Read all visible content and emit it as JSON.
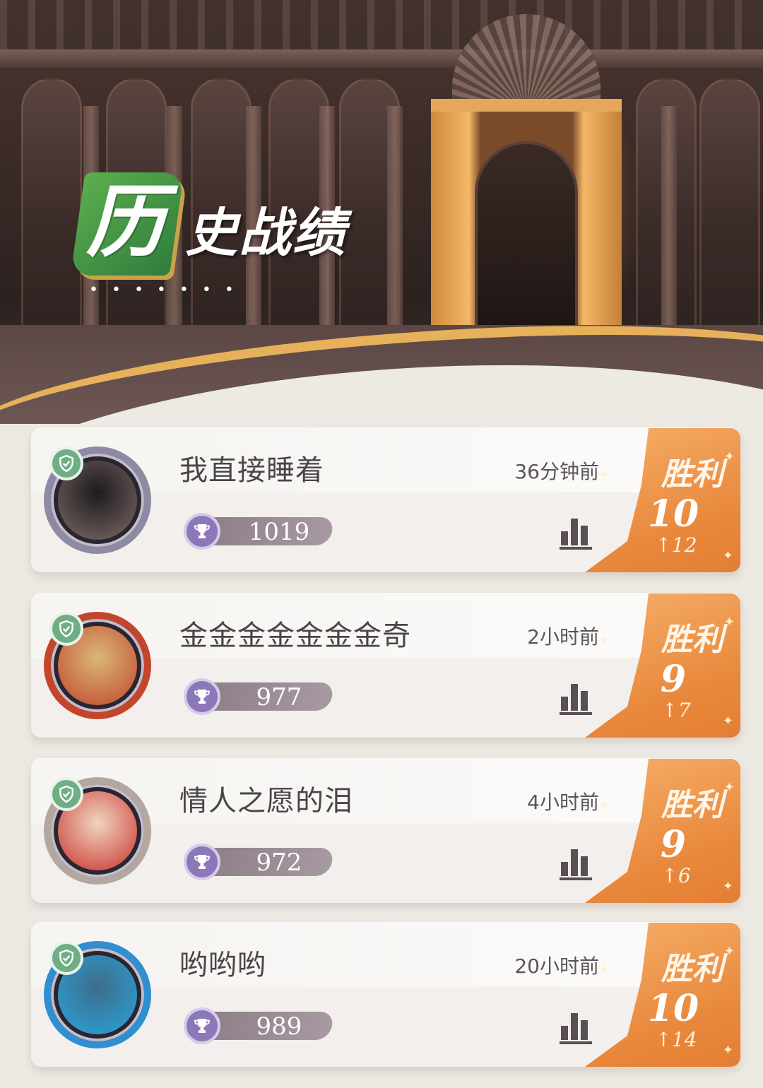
{
  "header": {
    "title_first_char": "历",
    "title_rest": "史战绩",
    "dots": "• • • • • • •"
  },
  "records": [
    {
      "name": "我直接睡着",
      "time": "36分钟前",
      "score": "1019",
      "result_label": "胜利",
      "result_value": "10",
      "result_change": "↑12",
      "avatar_colors": [
        "#1d1a1f",
        "#7d6a66"
      ],
      "ring_color": "#8f8aa3"
    },
    {
      "name": "金金金金金金金奇",
      "time": "2小时前",
      "score": "977",
      "result_label": "胜利",
      "result_value": "9",
      "result_change": "↑7",
      "avatar_colors": [
        "#d9b878",
        "#c2452c"
      ],
      "ring_color": "#c2452c"
    },
    {
      "name": "情人之愿的泪",
      "time": "4小时前",
      "score": "972",
      "result_label": "胜利",
      "result_value": "9",
      "result_change": "↑6",
      "avatar_colors": [
        "#f0d5c2",
        "#c8322a"
      ],
      "ring_color": "#b4a79f"
    },
    {
      "name": "哟哟哟",
      "time": "20小时前",
      "score": "989",
      "result_label": "胜利",
      "result_value": "10",
      "result_change": "↑14",
      "avatar_colors": [
        "#3d6d8c",
        "#2aa4d8"
      ],
      "ring_color": "#2f8fd0"
    }
  ]
}
